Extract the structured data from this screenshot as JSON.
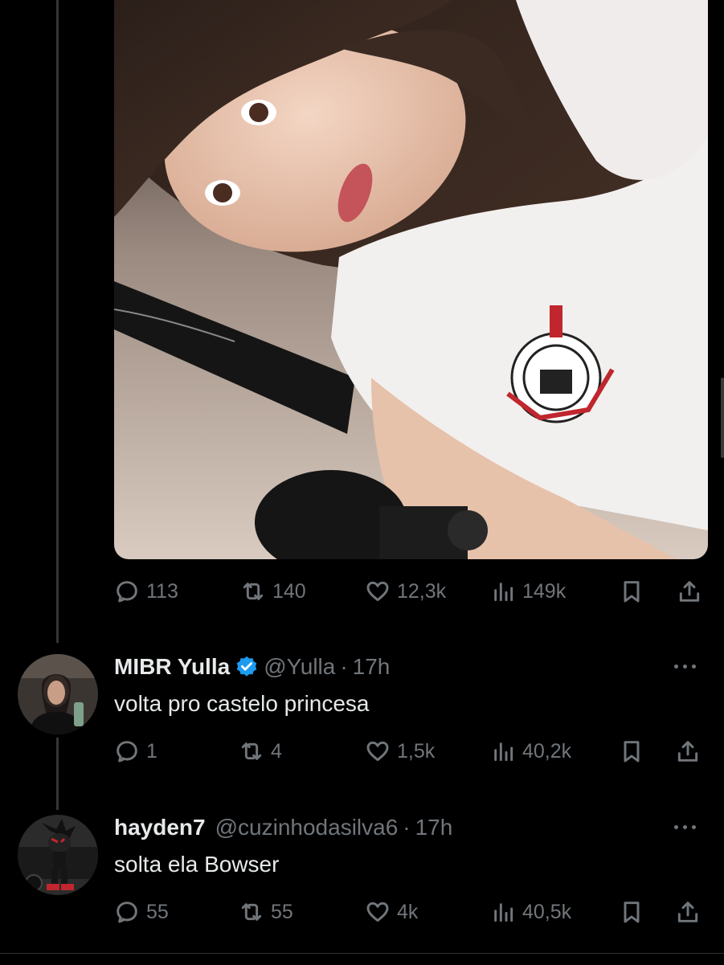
{
  "main_post": {
    "stats": {
      "replies": "113",
      "retweets": "140",
      "likes": "12,3k",
      "views": "149k"
    }
  },
  "replies": [
    {
      "name": "MIBR Yulla",
      "verified": true,
      "handle": "@Yulla",
      "separator": "·",
      "time": "17h",
      "text": "volta pro castelo princesa",
      "stats": {
        "replies": "1",
        "retweets": "4",
        "likes": "1,5k",
        "views": "40,2k"
      }
    },
    {
      "name": "hayden7",
      "verified": false,
      "handle": "@cuzinhodasilva6",
      "separator": "·",
      "time": "17h",
      "text": "solta ela Bowser",
      "stats": {
        "replies": "55",
        "retweets": "55",
        "likes": "4k",
        "views": "40,5k"
      }
    }
  ],
  "colors": {
    "background": "#000000",
    "text_primary": "#e7e9ea",
    "text_secondary": "#71767b",
    "verified_blue": "#1d9bf0",
    "thread_line": "#333639"
  },
  "icons": [
    "reply-icon",
    "retweet-icon",
    "like-icon",
    "views-icon",
    "bookmark-icon",
    "share-icon",
    "verified-icon",
    "more-icon"
  ]
}
